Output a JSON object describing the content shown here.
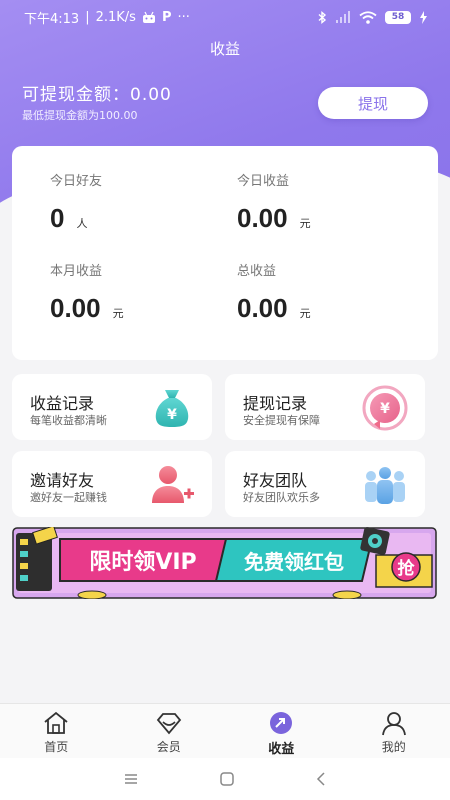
{
  "status_bar": {
    "time": "下午4:13",
    "speed": "2.1K/s",
    "battery": "58",
    "more": "···"
  },
  "header": {
    "title": "收益"
  },
  "balance": {
    "available_label": "可提现金额：0.00",
    "min_note": "最低提现金额为100.00",
    "withdraw_label": "提现"
  },
  "stats": [
    {
      "label": "今日好友",
      "value": "0",
      "unit": "人"
    },
    {
      "label": "今日收益",
      "value": "0.00",
      "unit": "元"
    },
    {
      "label": "本月收益",
      "value": "0.00",
      "unit": "元"
    },
    {
      "label": "总收益",
      "value": "0.00",
      "unit": "元"
    }
  ],
  "tiles": [
    {
      "title": "收益记录",
      "subtitle": "每笔收益都清晰",
      "icon": "money-bag-icon"
    },
    {
      "title": "提现记录",
      "subtitle": "安全提现有保障",
      "icon": "yuan-coin-icon"
    },
    {
      "title": "邀请好友",
      "subtitle": "邀好友一起赚钱",
      "icon": "add-user-icon"
    },
    {
      "title": "好友团队",
      "subtitle": "好友团队欢乐多",
      "icon": "team-icon"
    }
  ],
  "banner": {
    "left_text": "限时领VIP",
    "right_text": "免费领红包",
    "grab_text": "抢"
  },
  "tabbar": [
    {
      "label": "首页",
      "icon": "home-icon",
      "active": false
    },
    {
      "label": "会员",
      "icon": "vip-diamond-icon",
      "active": false
    },
    {
      "label": "收益",
      "icon": "earnings-icon",
      "active": true
    },
    {
      "label": "我的",
      "icon": "profile-icon",
      "active": false
    }
  ],
  "colors": {
    "accent": "#8a73ea",
    "banner_pink": "#e83a8a",
    "banner_teal": "#2ec5c0",
    "tile_teal": "#3ec5c2",
    "tile_pink": "#ef6a8a"
  }
}
